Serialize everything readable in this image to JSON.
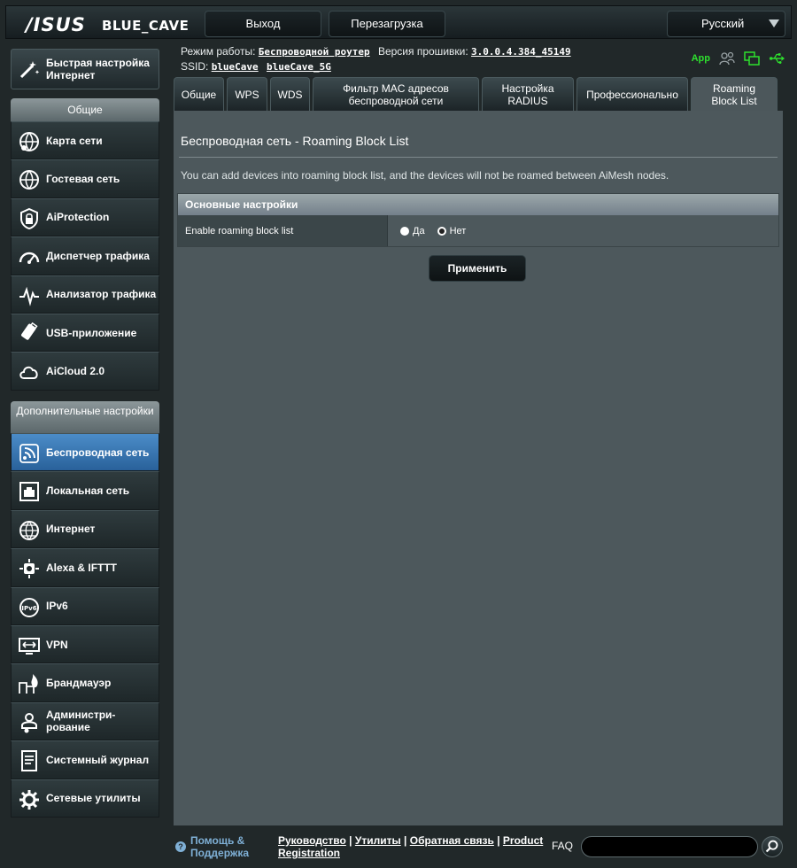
{
  "header": {
    "brand": "/ISUS",
    "model": "BLUE_CAVE",
    "logout_label": "Выход",
    "reboot_label": "Перезагрузка",
    "language": "Русский"
  },
  "status": {
    "mode_label": "Режим работы:",
    "mode_value": "Беспроводной роутер",
    "firmware_label": "Версия прошивки:",
    "firmware_value": "3.0.0.4.384_45149",
    "ssid_label": "SSID:",
    "ssid_1": "blueCave",
    "ssid_2": "blueCave_5G",
    "app_label": "App"
  },
  "sidebar": {
    "quick_setup": "Быстрая настройка Интернет",
    "general_header": "Общие",
    "general_items": [
      {
        "label": "Карта сети",
        "icon": "network-map-icon"
      },
      {
        "label": "Гостевая сеть",
        "icon": "guest-network-icon"
      },
      {
        "label": "AiProtection",
        "icon": "aiprotection-icon"
      },
      {
        "label": "Диспетчер трафика",
        "icon": "traffic-manager-icon"
      },
      {
        "label": "Анализатор трафика",
        "icon": "traffic-analyzer-icon"
      },
      {
        "label": "USB-приложение",
        "icon": "usb-app-icon"
      },
      {
        "label": "AiCloud 2.0",
        "icon": "aicloud-icon"
      }
    ],
    "advanced_header": "Дополнительные настройки",
    "advanced_items": [
      {
        "label": "Беспроводная сеть",
        "icon": "wireless-icon",
        "active": true
      },
      {
        "label": "Локальная сеть",
        "icon": "lan-icon"
      },
      {
        "label": "Интернет",
        "icon": "wan-icon"
      },
      {
        "label": "Alexa & IFTTT",
        "icon": "alexa-icon"
      },
      {
        "label": "IPv6",
        "icon": "ipv6-icon"
      },
      {
        "label": "VPN",
        "icon": "vpn-icon"
      },
      {
        "label": "Брандмауэр",
        "icon": "firewall-icon"
      },
      {
        "label": "Администри-рование",
        "icon": "administration-icon"
      },
      {
        "label": "Системный журнал",
        "icon": "system-log-icon"
      },
      {
        "label": "Сетевые утилиты",
        "icon": "network-tools-icon"
      }
    ]
  },
  "tabs": [
    {
      "label": "Общие"
    },
    {
      "label": "WPS"
    },
    {
      "label": "WDS"
    },
    {
      "label": "Фильтр MAC адресов беспроводной сети"
    },
    {
      "label": "Настройка RADIUS"
    },
    {
      "label": "Профессионально"
    },
    {
      "label": "Roaming Block List",
      "active": true
    }
  ],
  "main": {
    "title": "Беспроводная сеть - Roaming Block List",
    "description": "You can add devices into roaming block list, and the devices will not be roamed between AiMesh nodes.",
    "section_header": "Основные настройки",
    "setting_label": "Enable roaming block list",
    "option_yes": "Да",
    "option_no": "Нет",
    "selected_option": "Нет",
    "apply_label": "Применить"
  },
  "footer": {
    "help_label": "Помощь & Поддержка",
    "link_manual": "Руководство",
    "link_utilities": "Утилиты",
    "link_feedback": "Обратная связь",
    "link_registration": "Product Registration",
    "faq_label": "FAQ",
    "search_value": ""
  }
}
